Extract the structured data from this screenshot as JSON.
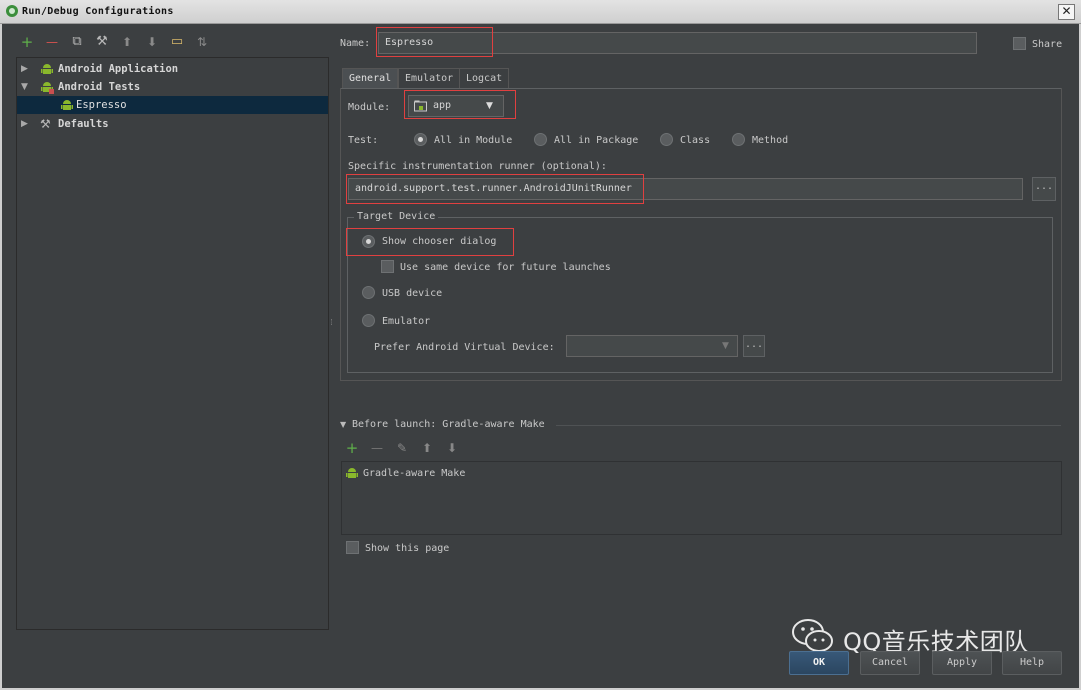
{
  "window": {
    "title": "Run/Debug Configurations",
    "close_glyph": "✕"
  },
  "tree_toolbar": {
    "icons": [
      "add-icon",
      "remove-icon",
      "copy-icon",
      "edit-defaults-icon",
      "move-up-icon",
      "move-down-icon",
      "folder-icon",
      "sort-icon"
    ],
    "glyphs": {
      "add": "+",
      "remove": "—",
      "copy": "⧉",
      "wrench": "⚒",
      "up": "⬆",
      "down": "⬇",
      "folder": "▭",
      "sort": "⇅"
    }
  },
  "tree": {
    "items": [
      {
        "label": "Android Application",
        "arrow": "▶"
      },
      {
        "label": "Android Tests",
        "arrow": "▼"
      },
      {
        "label": "Espresso",
        "selected": true
      },
      {
        "label": "Defaults",
        "arrow": "▶"
      }
    ]
  },
  "form": {
    "name_label": "Name:",
    "name_value": "Espresso",
    "share_label": "Share",
    "tabs": [
      "General",
      "Emulator",
      "Logcat"
    ],
    "module_label": "Module:",
    "module_value": "app",
    "test_label": "Test:",
    "test_options": [
      "All in Module",
      "All in Package",
      "Class",
      "Method"
    ],
    "runner_label": "Specific instrumentation runner (optional):",
    "runner_value": "android.support.test.runner.AndroidJUnitRunner",
    "ellipsis": "...",
    "dropdown_arrow": "▼",
    "target_device": {
      "title": "Target Device",
      "show_chooser": "Show chooser dialog",
      "same_device": "Use same device for future launches",
      "usb_device": "USB device",
      "emulator": "Emulator",
      "prefer_avd": "Prefer Android Virtual Device:"
    },
    "before_launch": {
      "title": "Before launch: Gradle-aware Make",
      "items": [
        "Gradle-aware Make"
      ]
    },
    "show_page": "Show this page"
  },
  "buttons": {
    "ok": "OK",
    "cancel": "Cancel",
    "apply": "Apply",
    "help": "Help"
  },
  "watermark": {
    "text": "QQ音乐技术团队"
  },
  "colors": {
    "android_green": "#8ab82c",
    "accent_red": "#e04040",
    "selection": "#0d293e"
  }
}
